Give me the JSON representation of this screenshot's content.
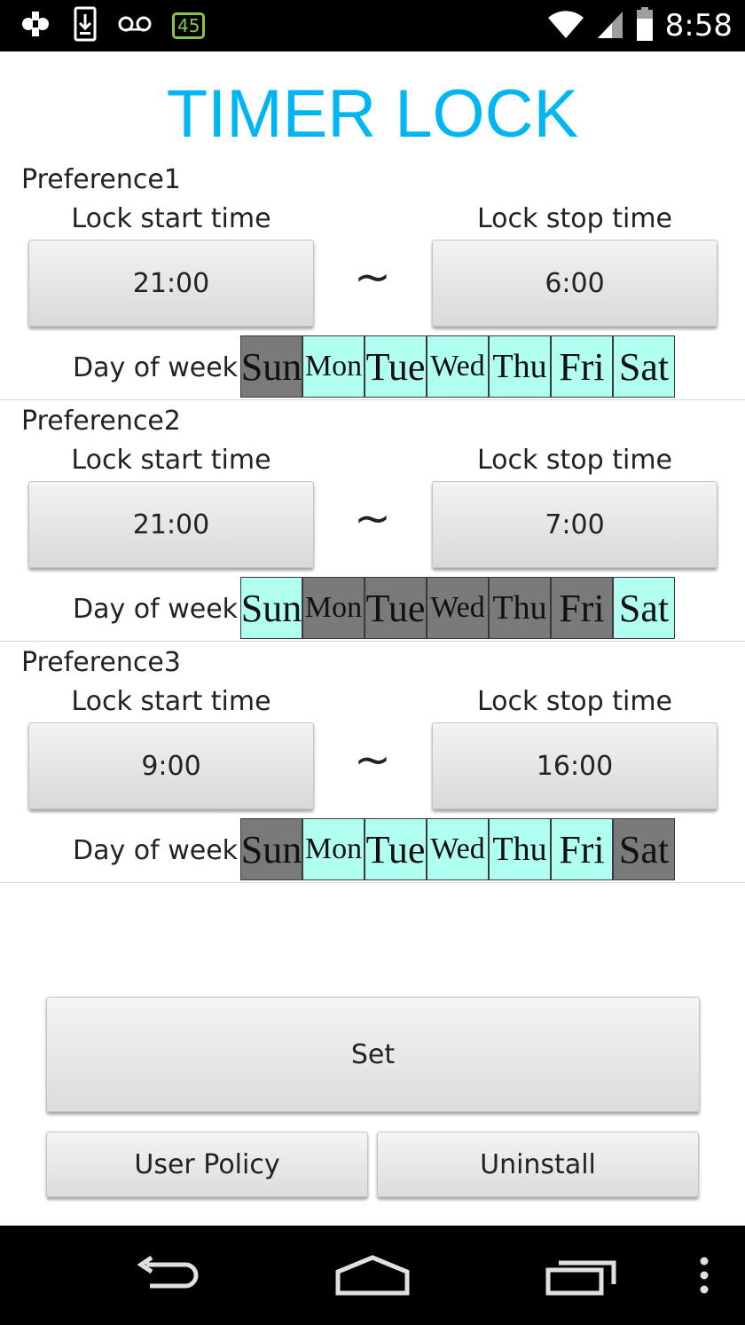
{
  "status_bar": {
    "time": "8:58",
    "battery_badge": "45",
    "icons": [
      "usb-debug-icon",
      "download-icon",
      "voicemail-icon",
      "battery-badge",
      "wifi-icon",
      "signal-icon",
      "battery-icon"
    ]
  },
  "title": "TIMER LOCK",
  "preferences": [
    {
      "label": "Preference1",
      "start_label": "Lock start time",
      "stop_label": "Lock stop time",
      "start_time": "21:00",
      "stop_time": "6:00",
      "separator": "~",
      "dow_label": "Day of week",
      "days": [
        {
          "name": "Sun",
          "active": false
        },
        {
          "name": "Mon",
          "active": true
        },
        {
          "name": "Tue",
          "active": true
        },
        {
          "name": "Wed",
          "active": true
        },
        {
          "name": "Thu",
          "active": true
        },
        {
          "name": "Fri",
          "active": true
        },
        {
          "name": "Sat",
          "active": true
        }
      ]
    },
    {
      "label": "Preference2",
      "start_label": "Lock start time",
      "stop_label": "Lock stop time",
      "start_time": "21:00",
      "stop_time": "7:00",
      "separator": "~",
      "dow_label": "Day of week",
      "days": [
        {
          "name": "Sun",
          "active": true
        },
        {
          "name": "Mon",
          "active": false
        },
        {
          "name": "Tue",
          "active": false
        },
        {
          "name": "Wed",
          "active": false
        },
        {
          "name": "Thu",
          "active": false
        },
        {
          "name": "Fri",
          "active": false
        },
        {
          "name": "Sat",
          "active": true
        }
      ]
    },
    {
      "label": "Preference3",
      "start_label": "Lock start time",
      "stop_label": "Lock stop time",
      "start_time": "9:00",
      "stop_time": "16:00",
      "separator": "~",
      "dow_label": "Day of week",
      "days": [
        {
          "name": "Sun",
          "active": false
        },
        {
          "name": "Mon",
          "active": true
        },
        {
          "name": "Tue",
          "active": true
        },
        {
          "name": "Wed",
          "active": true
        },
        {
          "name": "Thu",
          "active": true
        },
        {
          "name": "Fri",
          "active": true
        },
        {
          "name": "Sat",
          "active": false
        }
      ]
    }
  ],
  "actions": {
    "set_label": "Set",
    "user_policy_label": "User Policy",
    "uninstall_label": "Uninstall"
  },
  "colors": {
    "title": "#00b6f2",
    "day_active": "#b1fff1",
    "day_inactive": "#7a7a7a"
  },
  "nav_bar": {
    "icons": [
      "back-icon",
      "home-icon",
      "recents-icon",
      "overflow-menu-icon"
    ]
  }
}
